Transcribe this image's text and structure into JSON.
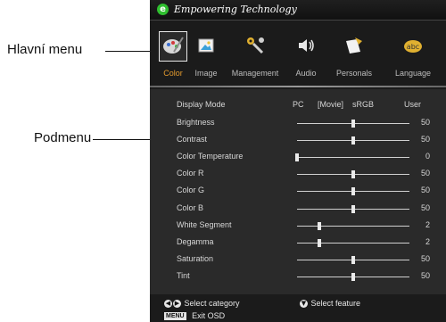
{
  "callouts": {
    "main_menu": "Hlavní menu",
    "submenu": "Podmenu"
  },
  "header": {
    "brand_text": "Empowering Technology",
    "logo_glyph": "e",
    "logo_color": "#2fbf2f"
  },
  "tabs": [
    {
      "label": "Color",
      "icon": "palette-icon",
      "selected": true
    },
    {
      "label": "Image",
      "icon": "image-icon",
      "selected": false
    },
    {
      "label": "Management",
      "icon": "wrench-gear-icon",
      "selected": false
    },
    {
      "label": "Audio",
      "icon": "speaker-icon",
      "selected": false
    },
    {
      "label": "Personals",
      "icon": "personal-folder-icon",
      "selected": false
    },
    {
      "label": "Language",
      "icon": "abc-language-icon",
      "selected": false
    }
  ],
  "display_mode": {
    "label": "Display Mode",
    "options": [
      "PC",
      "[Movie]",
      "sRGB",
      "User"
    ],
    "selected": "[Movie]"
  },
  "settings": [
    {
      "label": "Brightness",
      "value": "50",
      "level": 0.5
    },
    {
      "label": "Contrast",
      "value": "50",
      "level": 0.5
    },
    {
      "label": "Color Temperature",
      "value": "0",
      "level": 0.0
    },
    {
      "label": "Color R",
      "value": "50",
      "level": 0.5
    },
    {
      "label": "Color G",
      "value": "50",
      "level": 0.5
    },
    {
      "label": "Color B",
      "value": "50",
      "level": 0.5
    },
    {
      "label": "White Segment",
      "value": "2",
      "level": 0.2
    },
    {
      "label": "Degamma",
      "value": "2",
      "level": 0.2
    },
    {
      "label": "Saturation",
      "value": "50",
      "level": 0.5
    },
    {
      "label": "Tint",
      "value": "50",
      "level": 0.5
    }
  ],
  "footer": {
    "select_category": "Select category",
    "select_feature": "Select feature",
    "menu_key": "MENU",
    "exit_osd": "Exit OSD"
  },
  "colors": {
    "selected_tab_label": "#e39a2d",
    "panel_bg": "#2a2a2a",
    "osd_bg": "#1b1b1b"
  }
}
